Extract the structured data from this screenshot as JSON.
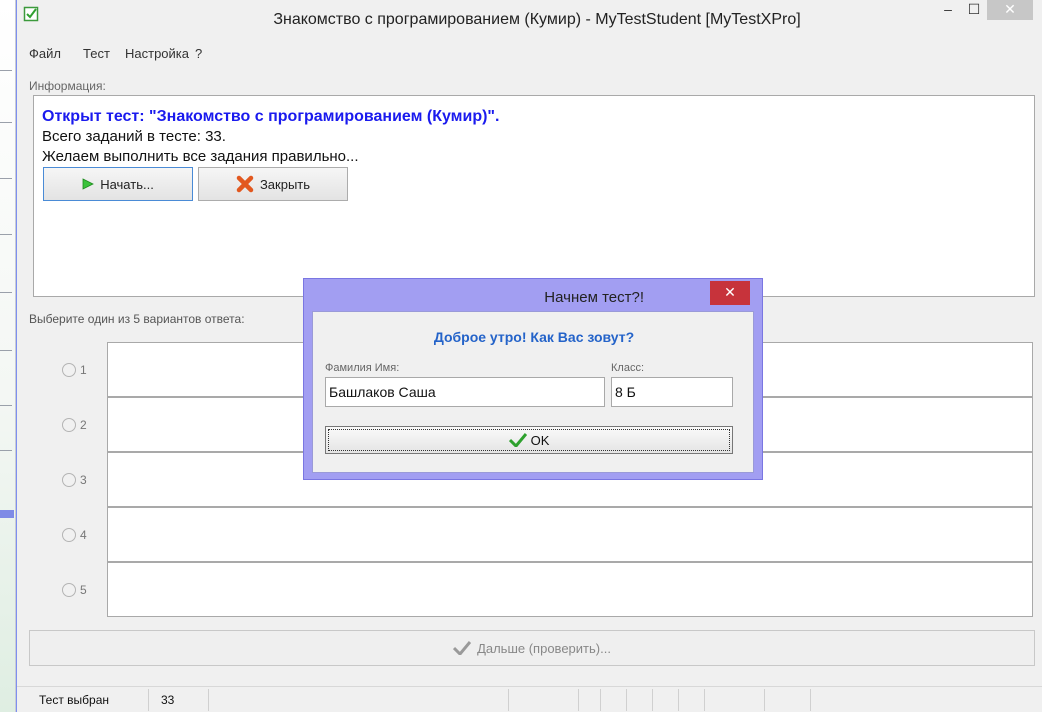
{
  "window": {
    "title": "Знакомство с програмированием (Кумир) - MyTestStudent [MyTestXPro]",
    "controls": {
      "minimize": "–",
      "maximize": "☐",
      "close": "✕"
    }
  },
  "menu": [
    "Файл",
    "Тест",
    "Настройка",
    "?"
  ],
  "info": {
    "label": "Информация:",
    "title": "Открыт тест: \"Знакомство с програмированием (Кумир)\".",
    "line1": "Всего заданий в тесте: 33.",
    "line2": "Желаем выполнить все задания правильно...",
    "start_button": "Начать...",
    "close_button": "Закрыть"
  },
  "question": {
    "label": "Выберите один из 5 вариантов ответа:",
    "options": [
      "1",
      "2",
      "3",
      "4",
      "5"
    ]
  },
  "next_button": "Дальше (проверить)...",
  "status_bar": {
    "state": "Тест выбран",
    "count": "33"
  },
  "dialog": {
    "title": "Начнем тест?!",
    "greeting": "Доброе утро! Как Вас зовут?",
    "name_label": "Фамилия Имя:",
    "name_value": "Башлаков Саша",
    "class_label": "Класс:",
    "class_value": "8 Б",
    "ok_label": "OK",
    "close": "✕"
  },
  "colors": {
    "accent": "#1a1aee",
    "dialog_frame": "#a29ef2",
    "close_red": "#c7333b",
    "start_green": "#3ac23a"
  }
}
